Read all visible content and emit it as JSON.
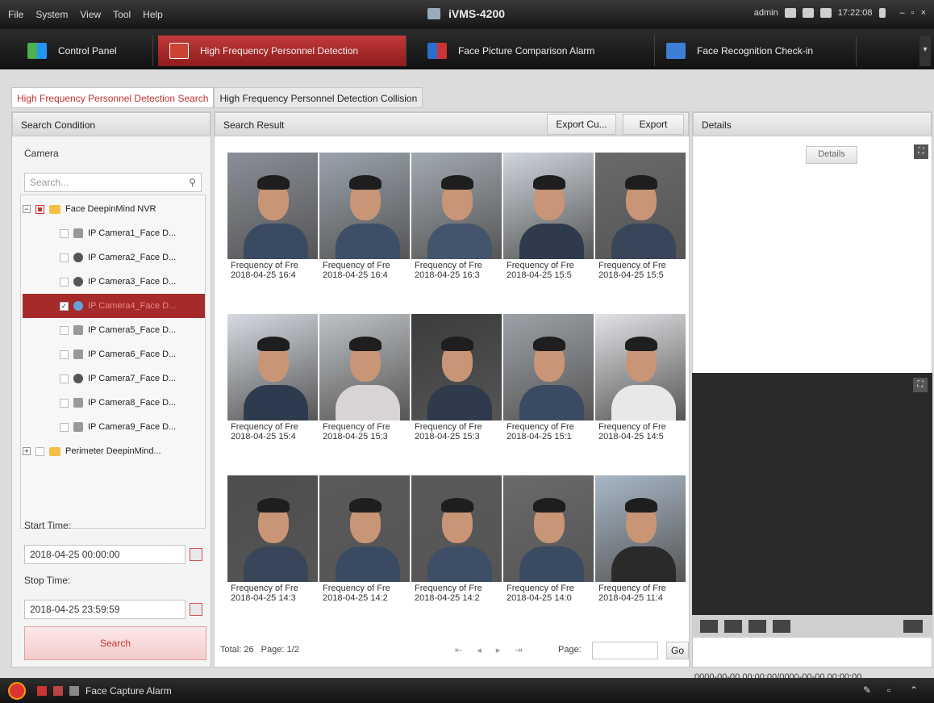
{
  "titlebar": {
    "menu": [
      "File",
      "System",
      "View",
      "Tool",
      "Help"
    ],
    "app_title": "iVMS-4200",
    "user": "admin",
    "clock": "17:22:08"
  },
  "navbar": {
    "tabs": [
      {
        "label": "Control Panel",
        "icon": "control-panel-icon"
      },
      {
        "label": "High Frequency Personnel Detection",
        "icon": "personnel-detection-icon"
      },
      {
        "label": "Face Picture Comparison Alarm",
        "icon": "face-comparison-icon"
      },
      {
        "label": "Face Recognition Check-in",
        "icon": "check-in-icon"
      }
    ]
  },
  "subtabs": [
    "High Frequency Personnel Detection Search",
    "High Frequency Personnel Detection Collision"
  ],
  "left": {
    "header": "Search Condition",
    "camera_label": "Camera",
    "search_placeholder": "Search...",
    "tree": [
      "Face DeepinMind NVR",
      "IP Camera1_Face D...",
      "IP Camera2_Face D...",
      "IP Camera3_Face D...",
      "IP Camera4_Face D...",
      "IP Camera5_Face D...",
      "IP Camera6_Face D...",
      "IP Camera7_Face D...",
      "IP Camera8_Face D...",
      "IP Camera9_Face D...",
      "Perimeter DeepinMind..."
    ],
    "start_label": "Start Time:",
    "start_value": "2018-04-25 00:00:00",
    "stop_label": "Stop Time:",
    "stop_value": "2018-04-25 23:59:59",
    "search_button": "Search"
  },
  "mid": {
    "header": "Search Result",
    "export_current": "Export Cu...",
    "export": "Export",
    "captions": {
      "title": "Frequency of Fre",
      "dates": [
        "2018-04-25 16:4",
        "2018-04-25 16:4",
        "2018-04-25 16:3",
        "2018-04-25 15:5",
        "2018-04-25 15:5",
        "2018-04-25 15:4",
        "2018-04-25 15:3",
        "2018-04-25 15:3",
        "2018-04-25 15:1",
        "2018-04-25 14:5",
        "2018-04-25 14:3",
        "2018-04-25 14:2",
        "2018-04-25 14:2",
        "2018-04-25 14:0",
        "2018-04-25 11:4"
      ]
    },
    "total": "Total: 26",
    "page": "Page: 1/2",
    "page_label": "Page:",
    "go": "Go"
  },
  "right": {
    "header": "Details",
    "details_button": "Details",
    "time_range": "0000-00-00 00:00:00/0000-00-00 00:00:00"
  },
  "statusbar": {
    "alarm_label": "Face Capture Alarm"
  }
}
